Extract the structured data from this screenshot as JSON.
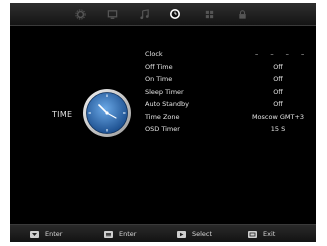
{
  "tabs": [
    {
      "icon": "gear-icon"
    },
    {
      "icon": "monitor-icon"
    },
    {
      "icon": "music-note-icon"
    },
    {
      "icon": "clock-icon",
      "active": true
    },
    {
      "icon": "grid-icon"
    },
    {
      "icon": "lock-icon"
    }
  ],
  "section": {
    "title": "TIME",
    "icon": "clock-icon"
  },
  "settings": [
    {
      "label": "Clock",
      "value": "– – – –"
    },
    {
      "label": "Off Time",
      "value": "Off"
    },
    {
      "label": "On Time",
      "value": "Off"
    },
    {
      "label": "Sleep Timer",
      "value": "Off"
    },
    {
      "label": "Auto Standby",
      "value": "Off"
    },
    {
      "label": "Time Zone",
      "value": "Moscow GMT+3"
    },
    {
      "label": "OSD Timer",
      "value": "15 S"
    }
  ],
  "hints": [
    {
      "icon": "enter-key-icon",
      "label": "Enter"
    },
    {
      "icon": "menu-key-icon",
      "label": "Enter"
    },
    {
      "icon": "select-key-icon",
      "label": "Select"
    },
    {
      "icon": "exit-key-icon",
      "label": "Exit"
    }
  ],
  "colors": {
    "background": "#000000",
    "text": "#e6e6e6",
    "clock_face": "#2f6fb3"
  }
}
